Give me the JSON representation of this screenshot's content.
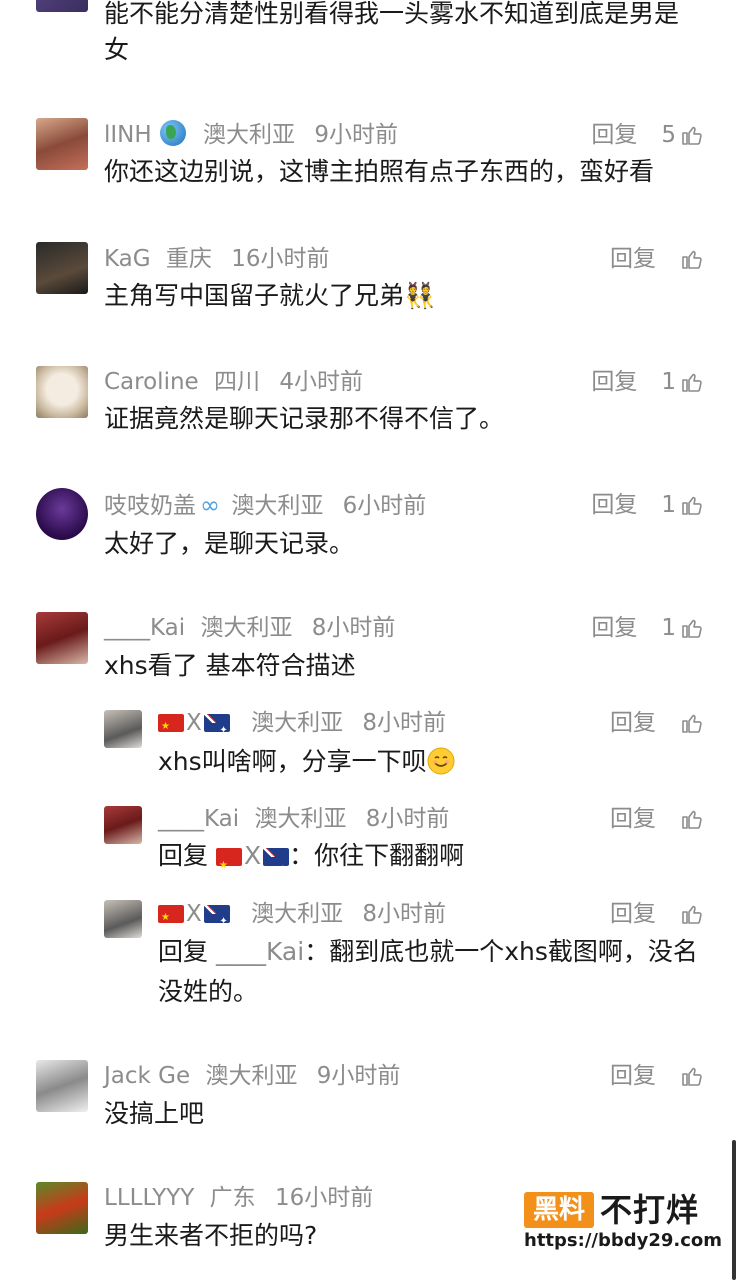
{
  "top_comment_tail": {
    "text_line1": "能不能分清楚性别看得我一头雾水不知道到底是男是",
    "text_line2": "女"
  },
  "comments": [
    {
      "name": "lINH",
      "location": "澳大利亚",
      "time": "9小时前",
      "reply_label": "回复",
      "likes": "5",
      "text": "你还这边别说，这博主拍照有点子东西的，蛮好看"
    },
    {
      "name": "KaG",
      "location": "重庆",
      "time": "16小时前",
      "reply_label": "回复",
      "likes": "",
      "text": "主角写中国留子就火了兄弟👯"
    },
    {
      "name": "Caroline",
      "location": "四川",
      "time": "4小时前",
      "reply_label": "回复",
      "likes": "1",
      "text": "证据竟然是聊天记录那不得不信了。"
    },
    {
      "name": "吱吱奶盖",
      "location": "澳大利亚",
      "time": "6小时前",
      "reply_label": "回复",
      "likes": "1",
      "text": "太好了，是聊天记录。"
    },
    {
      "name": "____Kai",
      "location": "澳大利亚",
      "time": "8小时前",
      "reply_label": "回复",
      "likes": "1",
      "text": "xhs看了 基本符合描述"
    }
  ],
  "replies": [
    {
      "name_mid": "X",
      "location": "澳大利亚",
      "time": "8小时前",
      "reply_label": "回复",
      "text": "xhs叫啥啊，分享一下呗"
    },
    {
      "name": "____Kai",
      "location": "澳大利亚",
      "time": "8小时前",
      "reply_label": "回复",
      "text_prefix": "回复 ",
      "text_mid": "X",
      "text_suffix": "：你往下翻翻啊"
    },
    {
      "name_mid": "X",
      "location": "澳大利亚",
      "time": "8小时前",
      "reply_label": "回复",
      "text_prefix": "回复 ",
      "text_target": "____Kai",
      "text_line1": "：翻到底也就一个xhs截图啊，没名",
      "text_line2": "没姓的。"
    }
  ],
  "comments_after": [
    {
      "name": "Jack Ge",
      "location": "澳大利亚",
      "time": "9小时前",
      "reply_label": "回复",
      "likes": "",
      "text": "没搞上吧"
    },
    {
      "name": "LLLLYYY",
      "location": "广东",
      "time": "16小时前",
      "reply_label": "回复",
      "likes": "",
      "text": "男生来者不拒的吗?"
    }
  ],
  "watermark": {
    "box": "黑料",
    "title": "不打烊",
    "url": "https://bbdy29.com"
  },
  "colors": {
    "meta_gray": "#8c8c8c",
    "text": "#1a1a1a",
    "watermark_orange": "#f39019"
  }
}
